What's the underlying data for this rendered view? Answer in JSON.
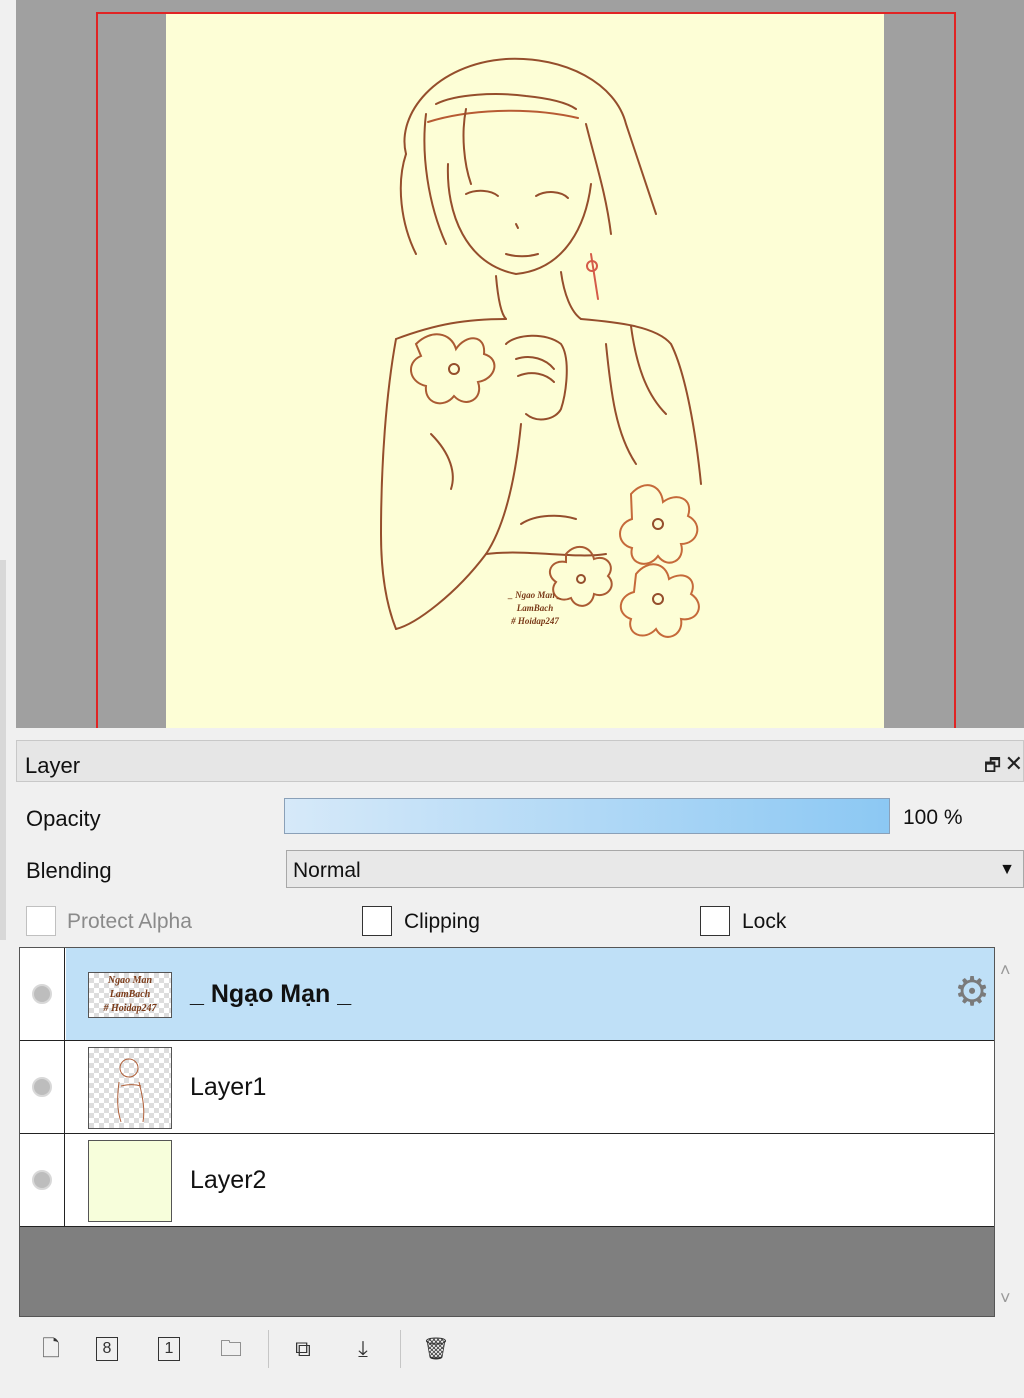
{
  "panel": {
    "title": "Layer",
    "float_glyph": "🗗",
    "close_glyph": "✕"
  },
  "opacity": {
    "label": "Opacity",
    "value_text": "100 %",
    "value": 1.0
  },
  "blending": {
    "label": "Blending",
    "selected": "Normal",
    "arrow": "▼"
  },
  "options": {
    "protect_alpha": {
      "label": "Protect Alpha",
      "checked": false,
      "enabled": false
    },
    "clipping": {
      "label": "Clipping",
      "checked": false
    },
    "lock": {
      "label": "Lock",
      "checked": false
    }
  },
  "canvas": {
    "signature_lines": [
      "_ Ngao Man _",
      "LamBach",
      "# Hoidap247"
    ]
  },
  "layers": [
    {
      "name": "_ Ngạo Mạn _",
      "selected": true,
      "thumb_lines": [
        "Ngao Man",
        "LamBach",
        "# Hoidap247"
      ],
      "settings_icon": "gear-icon"
    },
    {
      "name": "Layer1",
      "selected": false
    },
    {
      "name": "Layer2",
      "selected": false
    }
  ],
  "scroll": {
    "up": "˄",
    "down": "˅"
  },
  "toolbar": {
    "new_layer": "🗋",
    "new_8bit": "8",
    "new_1bit": "1",
    "new_folder": "🗀",
    "duplicate": "⧉",
    "merge_down": "⤓",
    "delete": "🗑"
  },
  "colors": {
    "selection": "#bfe0f7",
    "frame": "#e02424",
    "paper": "#fdfed6",
    "sketch": "#8a3c1a"
  }
}
